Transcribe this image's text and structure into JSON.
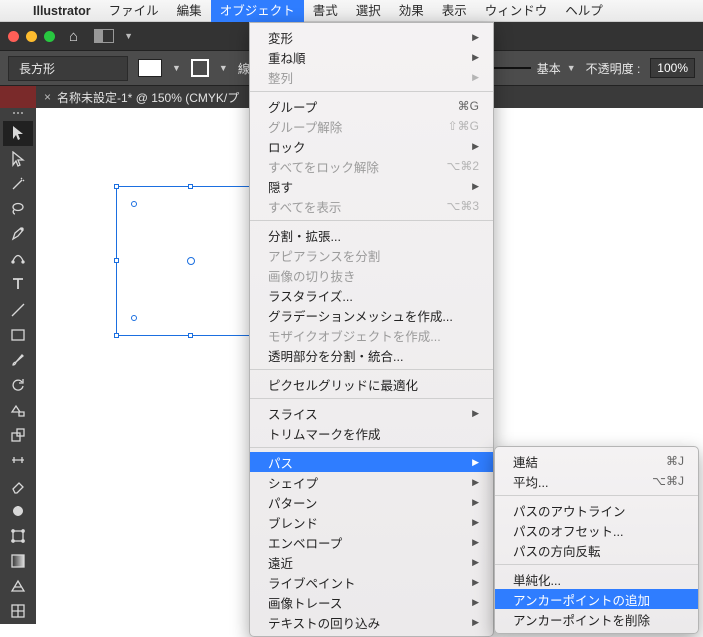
{
  "menubar": {
    "appname": "Illustrator",
    "items": [
      "ファイル",
      "編集",
      "オブジェクト",
      "書式",
      "選択",
      "効果",
      "表示",
      "ウィンドウ",
      "ヘルプ"
    ],
    "openIndex": 2
  },
  "ctrl": {
    "toolLabel": "長方形",
    "strokeLabel": "線",
    "basicLabel": "基本",
    "opacityLabel": "不透明度 :",
    "opacityValue": "100%"
  },
  "doc": {
    "title": "名称未設定-1* @ 150% (CMYK/プ"
  },
  "menu1": [
    {
      "t": "変形",
      "sub": true
    },
    {
      "t": "重ね順",
      "sub": true
    },
    {
      "t": "整列",
      "sub": true,
      "dis": true
    },
    {
      "sep": true
    },
    {
      "t": "グループ",
      "sc": "⌘G"
    },
    {
      "t": "グループ解除",
      "sc": "⇧⌘G",
      "dis": true
    },
    {
      "t": "ロック",
      "sub": true
    },
    {
      "t": "すべてをロック解除",
      "sc": "⌥⌘2",
      "dis": true
    },
    {
      "t": "隠す",
      "sub": true
    },
    {
      "t": "すべてを表示",
      "sc": "⌥⌘3",
      "dis": true
    },
    {
      "sep": true
    },
    {
      "t": "分割・拡張..."
    },
    {
      "t": "アピアランスを分割",
      "dis": true
    },
    {
      "t": "画像の切り抜き",
      "dis": true
    },
    {
      "t": "ラスタライズ..."
    },
    {
      "t": "グラデーションメッシュを作成..."
    },
    {
      "t": "モザイクオブジェクトを作成...",
      "dis": true
    },
    {
      "t": "透明部分を分割・統合..."
    },
    {
      "sep": true
    },
    {
      "t": "ピクセルグリッドに最適化"
    },
    {
      "sep": true
    },
    {
      "t": "スライス",
      "sub": true
    },
    {
      "t": "トリムマークを作成"
    },
    {
      "sep": true
    },
    {
      "t": "パス",
      "sub": true,
      "hi": true
    },
    {
      "t": "シェイプ",
      "sub": true
    },
    {
      "t": "パターン",
      "sub": true
    },
    {
      "t": "ブレンド",
      "sub": true
    },
    {
      "t": "エンベロープ",
      "sub": true
    },
    {
      "t": "遠近",
      "sub": true
    },
    {
      "t": "ライブペイント",
      "sub": true
    },
    {
      "t": "画像トレース",
      "sub": true
    },
    {
      "t": "テキストの回り込み",
      "sub": true
    }
  ],
  "menu2": [
    {
      "t": "連結",
      "sc": "⌘J"
    },
    {
      "t": "平均...",
      "sc": "⌥⌘J"
    },
    {
      "sep": true
    },
    {
      "t": "パスのアウトライン"
    },
    {
      "t": "パスのオフセット..."
    },
    {
      "t": "パスの方向反転"
    },
    {
      "sep": true
    },
    {
      "t": "単純化..."
    },
    {
      "t": "アンカーポイントの追加",
      "hi": true
    },
    {
      "t": "アンカーポイントを削除"
    }
  ],
  "tools": [
    "selection",
    "direct-select",
    "magic-wand",
    "lasso",
    "pen",
    "curvature",
    "type",
    "line",
    "rect",
    "brush",
    "rotate",
    "shaper",
    "scale",
    "width",
    "eraser",
    "blob-brush",
    "free-transform",
    "gradient",
    "perspective",
    "mesh",
    "symbol-spray",
    "column-graph",
    "artboard",
    "slice"
  ]
}
